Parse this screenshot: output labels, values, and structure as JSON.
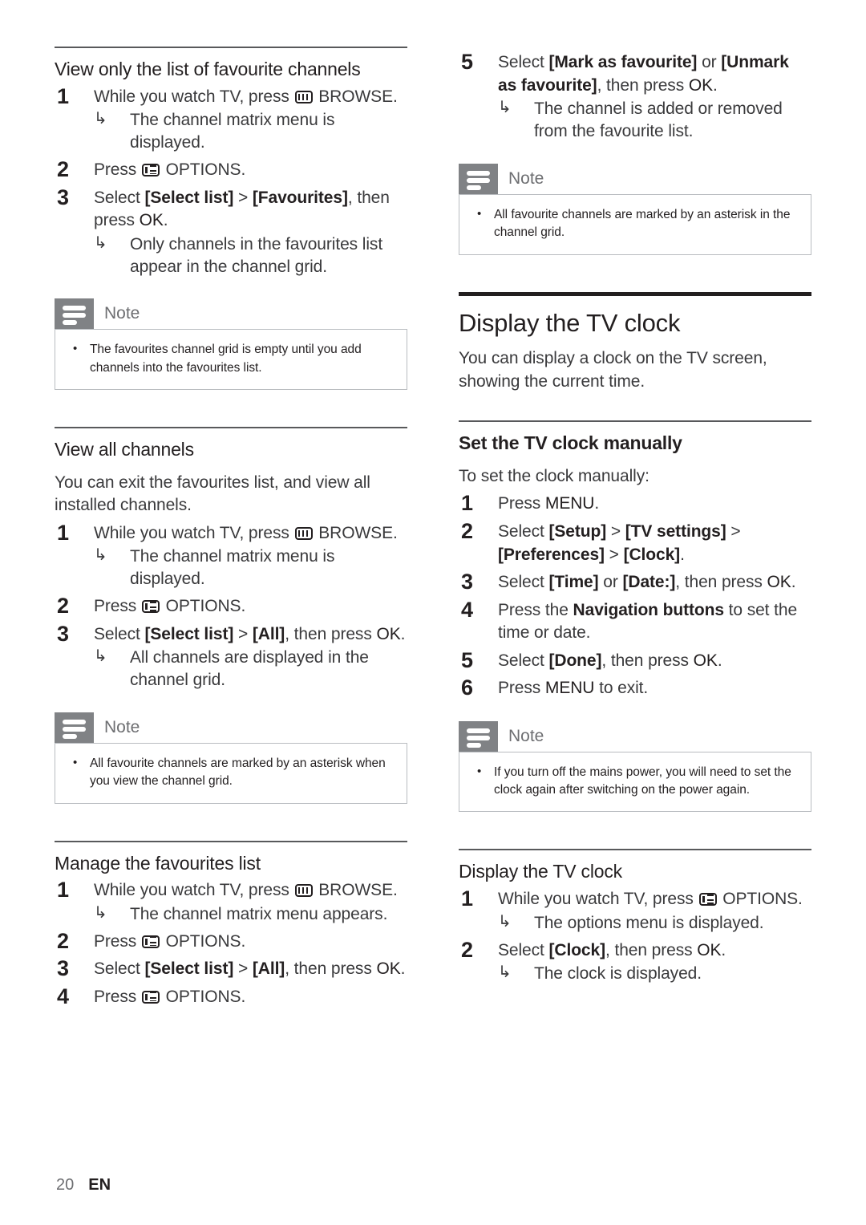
{
  "page": {
    "number": "20",
    "language": "EN"
  },
  "icons": {
    "browse": "browse-icon",
    "options": "options-icon",
    "note": "note-icon",
    "result_arrow": "result-arrow-icon"
  },
  "left_column": {
    "section_1": {
      "title": "View only the list of favourite channels",
      "steps": [
        {
          "num": "1",
          "text_before_icon": "While you watch TV, press ",
          "icon": "browse",
          "text_after_icon": " BROWSE.",
          "result": "The channel matrix menu is displayed."
        },
        {
          "num": "2",
          "text_before_icon": "Press ",
          "icon": "options",
          "text_after_icon": " OPTIONS.",
          "result": ""
        },
        {
          "num": "3",
          "prefix": "Select ",
          "kw1": "[Select list]",
          "mid": " > ",
          "kw2": "[Favourites]",
          "suffix": ", then press ",
          "kw3": "OK",
          "end": ".",
          "result": "Only channels in the favourites list appear in the channel grid."
        }
      ],
      "note": {
        "label": "Note",
        "items": [
          "The favourites channel grid is empty until you add channels into the favourites list."
        ]
      }
    },
    "section_2": {
      "title": "View all channels",
      "intro": "You can exit the favourites list, and view all installed channels.",
      "steps": [
        {
          "num": "1",
          "text_before_icon": "While you watch TV, press ",
          "icon": "browse",
          "text_after_icon": " BROWSE.",
          "result": "The channel matrix menu is displayed."
        },
        {
          "num": "2",
          "text_before_icon": "Press ",
          "icon": "options",
          "text_after_icon": " OPTIONS.",
          "result": ""
        },
        {
          "num": "3",
          "prefix": "Select ",
          "kw1": "[Select list]",
          "mid": " > ",
          "kw2": "[All]",
          "suffix": ", then press ",
          "kw3": "OK",
          "end": ".",
          "result": "All channels are displayed in the channel grid."
        }
      ],
      "note": {
        "label": "Note",
        "items": [
          "All favourite channels are marked by an asterisk when you view the channel grid."
        ]
      }
    },
    "section_3": {
      "title": "Manage the favourites list",
      "steps": [
        {
          "num": "1",
          "text_before_icon": "While you watch TV, press ",
          "icon": "browse",
          "text_after_icon": " BROWSE.",
          "result": "The channel matrix menu appears."
        },
        {
          "num": "2",
          "text_before_icon": "Press ",
          "icon": "options",
          "text_after_icon": " OPTIONS.",
          "result": ""
        },
        {
          "num": "3",
          "prefix": "Select ",
          "kw1": "[Select list]",
          "mid": " > ",
          "kw2": "[All]",
          "suffix": ", then press ",
          "kw3": "OK",
          "end": ".",
          "result": ""
        },
        {
          "num": "4",
          "text_before_icon": "Press ",
          "icon": "options",
          "text_after_icon": " OPTIONS.",
          "result": ""
        }
      ]
    }
  },
  "right_column": {
    "continued_step": {
      "num": "5",
      "prefix": "Select ",
      "kw1": "[Mark as favourite]",
      "mid": " or ",
      "kw2": "[Unmark as favourite]",
      "suffix": ", then press ",
      "kw3": "OK",
      "end": ".",
      "result": "The channel is added or removed from the favourite list."
    },
    "note_top": {
      "label": "Note",
      "items": [
        "All favourite channels are marked by an asterisk in the channel grid."
      ]
    },
    "section_main": {
      "title": "Display the TV clock",
      "intro": "You can display a clock on the TV screen, showing the current time."
    },
    "section_manual": {
      "title": "Set the TV clock manually",
      "intro": "To set the clock manually:",
      "steps": [
        {
          "num": "1",
          "plain_pre": "Press ",
          "kw1": "MENU",
          "plain_post": "."
        },
        {
          "num": "2",
          "prefix": "Select ",
          "kw1": "[Setup]",
          "mid": " > ",
          "kw2": "[TV settings]",
          "mid2": " > ",
          "kw3": "[Preferences]",
          "mid3": " > ",
          "kw4": "[Clock]",
          "end": "."
        },
        {
          "num": "3",
          "prefix": "Select ",
          "kw1": "[Time]",
          "mid": " or ",
          "kw2": "[Date:]",
          "suffix": ", then press ",
          "kw3": "OK",
          "end": "."
        },
        {
          "num": "4",
          "prefix": "Press the ",
          "kw1": "Navigation buttons",
          "suffix": " to set the time or date."
        },
        {
          "num": "5",
          "prefix": "Select ",
          "kw1": "[Done]",
          "suffix": ", then press ",
          "kw3": "OK",
          "end": "."
        },
        {
          "num": "6",
          "plain_pre": "Press ",
          "kw1": "MENU",
          "plain_post": " to exit."
        }
      ],
      "note": {
        "label": "Note",
        "items": [
          "If you turn off the mains power, you will need to set the clock again after switching on the power again."
        ]
      }
    },
    "section_display": {
      "title": "Display the TV clock",
      "steps": [
        {
          "num": "1",
          "text_before_icon": "While you watch TV, press ",
          "icon": "options",
          "text_after_icon": " OPTIONS.",
          "result": "The options menu is displayed."
        },
        {
          "num": "2",
          "prefix": "Select ",
          "kw1": "[Clock]",
          "suffix": ", then press ",
          "kw3": "OK",
          "end": ".",
          "result": "The clock is displayed."
        }
      ]
    }
  }
}
